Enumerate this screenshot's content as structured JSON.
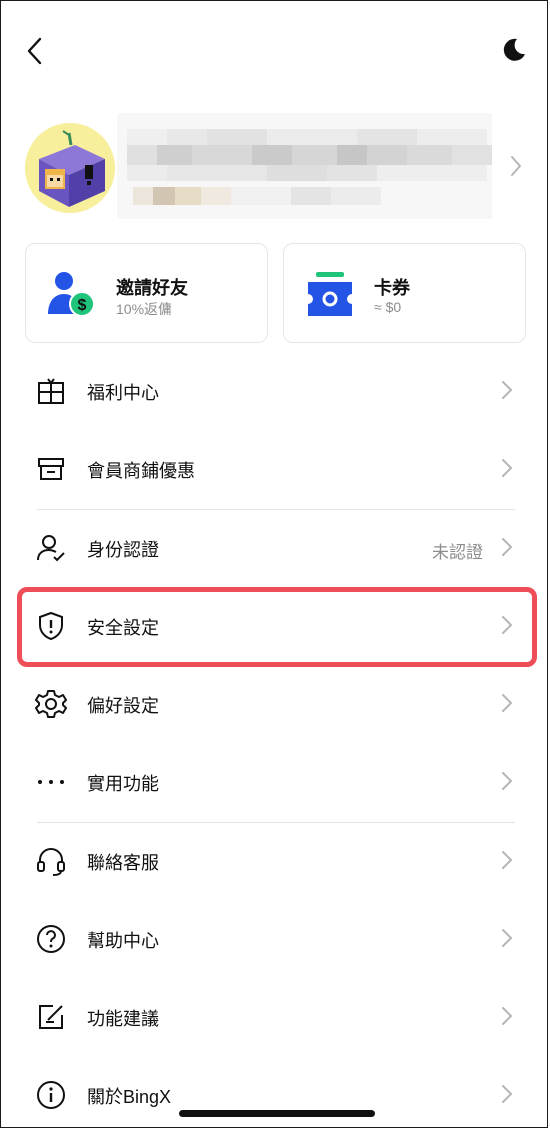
{
  "header": {
    "back_icon": "chevron-left-icon",
    "theme_icon": "moon-icon"
  },
  "profile": {
    "avatar_icon": "pixel-avatar-icon"
  },
  "cards": [
    {
      "title": "邀請好友",
      "subtitle": "10%返傭",
      "icon": "user-dollar-icon"
    },
    {
      "title": "卡券",
      "subtitle": "≈ $0",
      "icon": "ticket-icon"
    }
  ],
  "menu": [
    {
      "label": "福利中心",
      "icon": "gift-icon",
      "value": ""
    },
    {
      "label": "會員商鋪優惠",
      "icon": "store-icon",
      "value": ""
    },
    {
      "label": "身份認證",
      "icon": "user-check-icon",
      "value": "未認證"
    },
    {
      "label": "安全設定",
      "icon": "shield-alert-icon",
      "value": ""
    },
    {
      "label": "偏好設定",
      "icon": "gear-icon",
      "value": ""
    },
    {
      "label": "實用功能",
      "icon": "more-dots-icon",
      "value": ""
    },
    {
      "label": "聯絡客服",
      "icon": "headset-icon",
      "value": ""
    },
    {
      "label": "幫助中心",
      "icon": "question-circle-icon",
      "value": ""
    },
    {
      "label": "功能建議",
      "icon": "edit-square-icon",
      "value": ""
    },
    {
      "label": "關於BingX",
      "icon": "info-circle-icon",
      "value": ""
    }
  ],
  "colors": {
    "accent_blue": "#2354e6",
    "accent_green": "#1ec47a",
    "highlight_red": "#ee4e58",
    "text_secondary": "#8c8c8c"
  }
}
